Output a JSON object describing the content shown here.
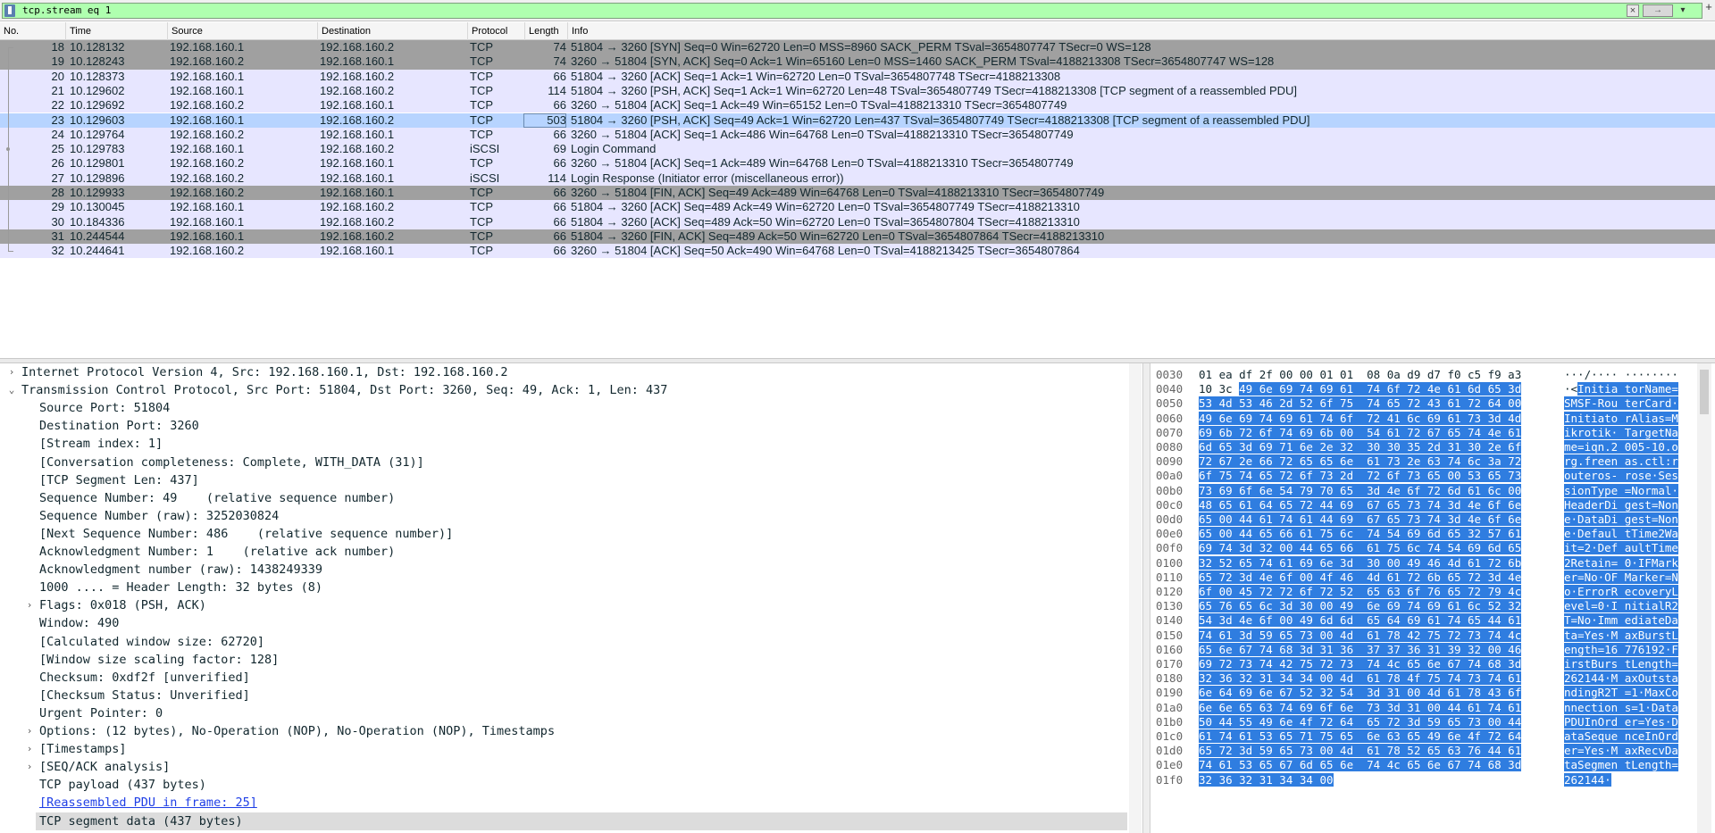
{
  "filter": {
    "text": "tcp.stream eq 1",
    "clear_icon": "×",
    "apply_icon": "→",
    "dropdown_icon": "▾",
    "add_icon": "+"
  },
  "columns": [
    "No.",
    "Time",
    "Source",
    "Destination",
    "Protocol",
    "Length",
    "Info"
  ],
  "packets": [
    {
      "no": "18",
      "time": "10.128132",
      "src": "192.168.160.1",
      "dst": "192.168.160.2",
      "proto": "TCP",
      "len": "74",
      "info": "51804 → 3260 [SYN] Seq=0 Win=62720 Len=0 MSS=8960 SACK_PERM TSval=3654807747 TSecr=0 WS=128",
      "style": "synfin"
    },
    {
      "no": "19",
      "time": "10.128243",
      "src": "192.168.160.2",
      "dst": "192.168.160.1",
      "proto": "TCP",
      "len": "74",
      "info": "3260 → 51804 [SYN, ACK] Seq=0 Ack=1 Win=65160 Len=0 MSS=1460 SACK_PERM TSval=4188213308 TSecr=3654807747 WS=128",
      "style": "synfin"
    },
    {
      "no": "20",
      "time": "10.128373",
      "src": "192.168.160.1",
      "dst": "192.168.160.2",
      "proto": "TCP",
      "len": "66",
      "info": "51804 → 3260 [ACK] Seq=1 Ack=1 Win=62720 Len=0 TSval=3654807748 TSecr=4188213308",
      "style": "tcp"
    },
    {
      "no": "21",
      "time": "10.129602",
      "src": "192.168.160.1",
      "dst": "192.168.160.2",
      "proto": "TCP",
      "len": "114",
      "info": "51804 → 3260 [PSH, ACK] Seq=1 Ack=1 Win=62720 Len=48 TSval=3654807749 TSecr=4188213308 [TCP segment of a reassembled PDU]",
      "style": "tcp"
    },
    {
      "no": "22",
      "time": "10.129692",
      "src": "192.168.160.2",
      "dst": "192.168.160.1",
      "proto": "TCP",
      "len": "66",
      "info": "3260 → 51804 [ACK] Seq=1 Ack=49 Win=65152 Len=0 TSval=4188213310 TSecr=3654807749",
      "style": "tcp"
    },
    {
      "no": "23",
      "time": "10.129603",
      "src": "192.168.160.1",
      "dst": "192.168.160.2",
      "proto": "TCP",
      "len": "503",
      "info": "51804 → 3260 [PSH, ACK] Seq=49 Ack=1 Win=62720 Len=437 TSval=3654807749 TSecr=4188213308 [TCP segment of a reassembled PDU]",
      "style": "sel"
    },
    {
      "no": "24",
      "time": "10.129764",
      "src": "192.168.160.2",
      "dst": "192.168.160.1",
      "proto": "TCP",
      "len": "66",
      "info": "3260 → 51804 [ACK] Seq=1 Ack=486 Win=64768 Len=0 TSval=4188213310 TSecr=3654807749",
      "style": "tcp"
    },
    {
      "no": "25",
      "time": "10.129783",
      "src": "192.168.160.1",
      "dst": "192.168.160.2",
      "proto": "iSCSI",
      "len": "69",
      "info": "Login Command",
      "style": "tcp"
    },
    {
      "no": "26",
      "time": "10.129801",
      "src": "192.168.160.2",
      "dst": "192.168.160.1",
      "proto": "TCP",
      "len": "66",
      "info": "3260 → 51804 [ACK] Seq=1 Ack=489 Win=64768 Len=0 TSval=4188213310 TSecr=3654807749",
      "style": "tcp"
    },
    {
      "no": "27",
      "time": "10.129896",
      "src": "192.168.160.2",
      "dst": "192.168.160.1",
      "proto": "iSCSI",
      "len": "114",
      "info": "Login Response (Initiator error (miscellaneous error))",
      "style": "tcp"
    },
    {
      "no": "28",
      "time": "10.129933",
      "src": "192.168.160.2",
      "dst": "192.168.160.1",
      "proto": "TCP",
      "len": "66",
      "info": "3260 → 51804 [FIN, ACK] Seq=49 Ack=489 Win=64768 Len=0 TSval=4188213310 TSecr=3654807749",
      "style": "synfin"
    },
    {
      "no": "29",
      "time": "10.130045",
      "src": "192.168.160.1",
      "dst": "192.168.160.2",
      "proto": "TCP",
      "len": "66",
      "info": "51804 → 3260 [ACK] Seq=489 Ack=49 Win=62720 Len=0 TSval=3654807749 TSecr=4188213310",
      "style": "tcp"
    },
    {
      "no": "30",
      "time": "10.184336",
      "src": "192.168.160.1",
      "dst": "192.168.160.2",
      "proto": "TCP",
      "len": "66",
      "info": "51804 → 3260 [ACK] Seq=489 Ack=50 Win=62720 Len=0 TSval=3654807804 TSecr=4188213310",
      "style": "tcp"
    },
    {
      "no": "31",
      "time": "10.244544",
      "src": "192.168.160.1",
      "dst": "192.168.160.2",
      "proto": "TCP",
      "len": "66",
      "info": "51804 → 3260 [FIN, ACK] Seq=489 Ack=50 Win=62720 Len=0 TSval=3654807864 TSecr=4188213310",
      "style": "synfin"
    },
    {
      "no": "32",
      "time": "10.244641",
      "src": "192.168.160.2",
      "dst": "192.168.160.1",
      "proto": "TCP",
      "len": "66",
      "info": "3260 → 51804 [ACK] Seq=50 Ack=490 Win=64768 Len=0 TSval=4188213425 TSecr=3654807864",
      "style": "tcp"
    }
  ],
  "details": [
    {
      "level": 0,
      "arrow": "›",
      "text": "Internet Protocol Version 4, Src: 192.168.160.1, Dst: 192.168.160.2"
    },
    {
      "level": 0,
      "arrow": "⌄",
      "text": "Transmission Control Protocol, Src Port: 51804, Dst Port: 3260, Seq: 49, Ack: 1, Len: 437"
    },
    {
      "level": 1,
      "arrow": "",
      "text": "Source Port: 51804"
    },
    {
      "level": 1,
      "arrow": "",
      "text": "Destination Port: 3260"
    },
    {
      "level": 1,
      "arrow": "",
      "text": "[Stream index: 1]"
    },
    {
      "level": 1,
      "arrow": "",
      "text": "[Conversation completeness: Complete, WITH_DATA (31)]"
    },
    {
      "level": 1,
      "arrow": "",
      "text": "[TCP Segment Len: 437]"
    },
    {
      "level": 1,
      "arrow": "",
      "text": "Sequence Number: 49    (relative sequence number)"
    },
    {
      "level": 1,
      "arrow": "",
      "text": "Sequence Number (raw): 3252030824"
    },
    {
      "level": 1,
      "arrow": "",
      "text": "[Next Sequence Number: 486    (relative sequence number)]"
    },
    {
      "level": 1,
      "arrow": "",
      "text": "Acknowledgment Number: 1    (relative ack number)"
    },
    {
      "level": 1,
      "arrow": "",
      "text": "Acknowledgment number (raw): 1438249339"
    },
    {
      "level": 1,
      "arrow": "",
      "text": "1000 .... = Header Length: 32 bytes (8)"
    },
    {
      "level": 1,
      "arrow": "›",
      "text": "Flags: 0x018 (PSH, ACK)"
    },
    {
      "level": 1,
      "arrow": "",
      "text": "Window: 490"
    },
    {
      "level": 1,
      "arrow": "",
      "text": "[Calculated window size: 62720]"
    },
    {
      "level": 1,
      "arrow": "",
      "text": "[Window size scaling factor: 128]"
    },
    {
      "level": 1,
      "arrow": "",
      "text": "Checksum: 0xdf2f [unverified]"
    },
    {
      "level": 1,
      "arrow": "",
      "text": "[Checksum Status: Unverified]"
    },
    {
      "level": 1,
      "arrow": "",
      "text": "Urgent Pointer: 0"
    },
    {
      "level": 1,
      "arrow": "›",
      "text": "Options: (12 bytes), No-Operation (NOP), No-Operation (NOP), Timestamps"
    },
    {
      "level": 1,
      "arrow": "›",
      "text": "[Timestamps]"
    },
    {
      "level": 1,
      "arrow": "›",
      "text": "[SEQ/ACK analysis]"
    },
    {
      "level": 1,
      "arrow": "",
      "text": "TCP payload (437 bytes)"
    },
    {
      "level": 1,
      "arrow": "",
      "text": "[Reassembled PDU in frame: 25]",
      "link": true
    },
    {
      "level": 1,
      "arrow": "",
      "text": "TCP segment data (437 bytes)",
      "selected": true
    }
  ],
  "bytes": [
    {
      "off": "0030",
      "hex_pre": "01 ea df 2f 00 00 01 01  08 0a d9 d7 f0 c5 f9 a3",
      "hex_hl": "",
      "asc_pre": "···/···· ········",
      "asc_hl": ""
    },
    {
      "off": "0040",
      "hex_pre": "10 3c ",
      "hex_hl": "49 6e 69 74 69 61  74 6f 72 4e 61 6d 65 3d",
      "asc_pre": "·<",
      "asc_hl": "Initia torName="
    },
    {
      "off": "0050",
      "hex_pre": "",
      "hex_hl": "53 4d 53 46 2d 52 6f 75  74 65 72 43 61 72 64 00",
      "asc_pre": "",
      "asc_hl": "SMSF-Rou terCard·"
    },
    {
      "off": "0060",
      "hex_pre": "",
      "hex_hl": "49 6e 69 74 69 61 74 6f  72 41 6c 69 61 73 3d 4d",
      "asc_pre": "",
      "asc_hl": "Initiato rAlias=M"
    },
    {
      "off": "0070",
      "hex_pre": "",
      "hex_hl": "69 6b 72 6f 74 69 6b 00  54 61 72 67 65 74 4e 61",
      "asc_pre": "",
      "asc_hl": "ikrotik· TargetNa"
    },
    {
      "off": "0080",
      "hex_pre": "",
      "hex_hl": "6d 65 3d 69 71 6e 2e 32  30 30 35 2d 31 30 2e 6f",
      "asc_pre": "",
      "asc_hl": "me=iqn.2 005-10.o"
    },
    {
      "off": "0090",
      "hex_pre": "",
      "hex_hl": "72 67 2e 66 72 65 65 6e  61 73 2e 63 74 6c 3a 72",
      "asc_pre": "",
      "asc_hl": "rg.freen as.ctl:r"
    },
    {
      "off": "00a0",
      "hex_pre": "",
      "hex_hl": "6f 75 74 65 72 6f 73 2d  72 6f 73 65 00 53 65 73",
      "asc_pre": "",
      "asc_hl": "outeros- rose·Ses"
    },
    {
      "off": "00b0",
      "hex_pre": "",
      "hex_hl": "73 69 6f 6e 54 79 70 65  3d 4e 6f 72 6d 61 6c 00",
      "asc_pre": "",
      "asc_hl": "sionType =Normal·"
    },
    {
      "off": "00c0",
      "hex_pre": "",
      "hex_hl": "48 65 61 64 65 72 44 69  67 65 73 74 3d 4e 6f 6e",
      "asc_pre": "",
      "asc_hl": "HeaderDi gest=Non"
    },
    {
      "off": "00d0",
      "hex_pre": "",
      "hex_hl": "65 00 44 61 74 61 44 69  67 65 73 74 3d 4e 6f 6e",
      "asc_pre": "",
      "asc_hl": "e·DataDi gest=Non"
    },
    {
      "off": "00e0",
      "hex_pre": "",
      "hex_hl": "65 00 44 65 66 61 75 6c  74 54 69 6d 65 32 57 61",
      "asc_pre": "",
      "asc_hl": "e·Defaul tTime2Wa"
    },
    {
      "off": "00f0",
      "hex_pre": "",
      "hex_hl": "69 74 3d 32 00 44 65 66  61 75 6c 74 54 69 6d 65",
      "asc_pre": "",
      "asc_hl": "it=2·Def aultTime"
    },
    {
      "off": "0100",
      "hex_pre": "",
      "hex_hl": "32 52 65 74 61 69 6e 3d  30 00 49 46 4d 61 72 6b",
      "asc_pre": "",
      "asc_hl": "2Retain= 0·IFMark"
    },
    {
      "off": "0110",
      "hex_pre": "",
      "hex_hl": "65 72 3d 4e 6f 00 4f 46  4d 61 72 6b 65 72 3d 4e",
      "asc_pre": "",
      "asc_hl": "er=No·OF Marker=N"
    },
    {
      "off": "0120",
      "hex_pre": "",
      "hex_hl": "6f 00 45 72 72 6f 72 52  65 63 6f 76 65 72 79 4c",
      "asc_pre": "",
      "asc_hl": "o·ErrorR ecoveryL"
    },
    {
      "off": "0130",
      "hex_pre": "",
      "hex_hl": "65 76 65 6c 3d 30 00 49  6e 69 74 69 61 6c 52 32",
      "asc_pre": "",
      "asc_hl": "evel=0·I nitialR2"
    },
    {
      "off": "0140",
      "hex_pre": "",
      "hex_hl": "54 3d 4e 6f 00 49 6d 6d  65 64 69 61 74 65 44 61",
      "asc_pre": "",
      "asc_hl": "T=No·Imm ediateDa"
    },
    {
      "off": "0150",
      "hex_pre": "",
      "hex_hl": "74 61 3d 59 65 73 00 4d  61 78 42 75 72 73 74 4c",
      "asc_pre": "",
      "asc_hl": "ta=Yes·M axBurstL"
    },
    {
      "off": "0160",
      "hex_pre": "",
      "hex_hl": "65 6e 67 74 68 3d 31 36  37 37 36 31 39 32 00 46",
      "asc_pre": "",
      "asc_hl": "ength=16 776192·F"
    },
    {
      "off": "0170",
      "hex_pre": "",
      "hex_hl": "69 72 73 74 42 75 72 73  74 4c 65 6e 67 74 68 3d",
      "asc_pre": "",
      "asc_hl": "irstBurs tLength="
    },
    {
      "off": "0180",
      "hex_pre": "",
      "hex_hl": "32 36 32 31 34 34 00 4d  61 78 4f 75 74 73 74 61",
      "asc_pre": "",
      "asc_hl": "262144·M axOutsta"
    },
    {
      "off": "0190",
      "hex_pre": "",
      "hex_hl": "6e 64 69 6e 67 52 32 54  3d 31 00 4d 61 78 43 6f",
      "asc_pre": "",
      "asc_hl": "ndingR2T =1·MaxCo"
    },
    {
      "off": "01a0",
      "hex_pre": "",
      "hex_hl": "6e 6e 65 63 74 69 6f 6e  73 3d 31 00 44 61 74 61",
      "asc_pre": "",
      "asc_hl": "nnection s=1·Data"
    },
    {
      "off": "01b0",
      "hex_pre": "",
      "hex_hl": "50 44 55 49 6e 4f 72 64  65 72 3d 59 65 73 00 44",
      "asc_pre": "",
      "asc_hl": "PDUInOrd er=Yes·D"
    },
    {
      "off": "01c0",
      "hex_pre": "",
      "hex_hl": "61 74 61 53 65 71 75 65  6e 63 65 49 6e 4f 72 64",
      "asc_pre": "",
      "asc_hl": "ataSeque nceInOrd"
    },
    {
      "off": "01d0",
      "hex_pre": "",
      "hex_hl": "65 72 3d 59 65 73 00 4d  61 78 52 65 63 76 44 61",
      "asc_pre": "",
      "asc_hl": "er=Yes·M axRecvDa"
    },
    {
      "off": "01e0",
      "hex_pre": "",
      "hex_hl": "74 61 53 65 67 6d 65 6e  74 4c 65 6e 67 74 68 3d",
      "asc_pre": "",
      "asc_hl": "taSegmen tLength="
    },
    {
      "off": "01f0",
      "hex_pre": "",
      "hex_hl": "32 36 32 31 34 34 00",
      "asc_pre": "",
      "asc_hl": "262144·"
    }
  ],
  "colors": {
    "tcp_row": "#e7e6ff",
    "synfin_row": "#a0a0a0",
    "selected_row": "#b7d4ff",
    "filter_bg": "#afffaf",
    "bytes_highlight": "#2f7de0"
  }
}
